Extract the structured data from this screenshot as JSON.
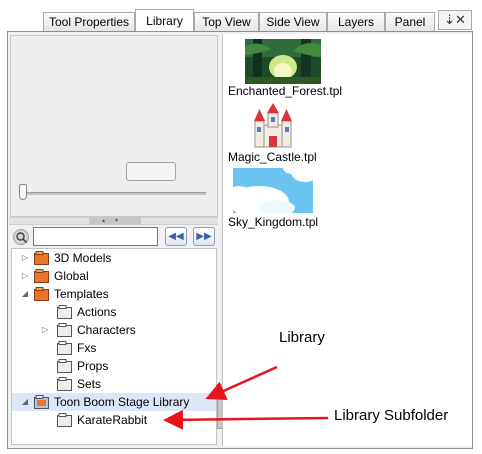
{
  "tabs": [
    {
      "label": "Tool Properties",
      "active": false
    },
    {
      "label": "Library",
      "active": true
    },
    {
      "label": "Top View",
      "active": false
    },
    {
      "label": "Side View",
      "active": false
    },
    {
      "label": "Layers",
      "active": false
    },
    {
      "label": "Panel",
      "active": false
    }
  ],
  "tab_controls": {
    "icon": "menu-close-icon",
    "glyph": "⇣✕"
  },
  "search": {
    "value": "",
    "placeholder": ""
  },
  "tree": {
    "items": [
      {
        "label": "3D Models",
        "expander": "collapsed",
        "icon": "folder-icon"
      },
      {
        "label": "Global",
        "expander": "collapsed",
        "icon": "folder-icon"
      },
      {
        "label": "Templates",
        "expander": "expanded",
        "icon": "folder-icon"
      },
      {
        "label": "Actions",
        "expander": "none",
        "icon": "subfolder-icon"
      },
      {
        "label": "Characters",
        "expander": "collapsed",
        "icon": "subfolder-icon"
      },
      {
        "label": "Fxs",
        "expander": "none",
        "icon": "subfolder-icon"
      },
      {
        "label": "Props",
        "expander": "none",
        "icon": "subfolder-icon"
      },
      {
        "label": "Sets",
        "expander": "none",
        "icon": "subfolder-icon"
      },
      {
        "label": "Toon Boom Stage Library",
        "expander": "expanded",
        "icon": "library-folder-icon",
        "selected": true
      },
      {
        "label": "KarateRabbit",
        "expander": "none",
        "icon": "subfolder-icon"
      }
    ]
  },
  "templates": [
    {
      "label": "Enchanted_Forest.tpl",
      "thumb": "forest-thumbnail"
    },
    {
      "label": "Magic_Castle.tpl",
      "thumb": "castle-thumbnail"
    },
    {
      "label": "Sky_Kingdom.tpl",
      "thumb": "sky-thumbnail"
    }
  ],
  "annotations": {
    "library": "Library",
    "library_subfolder": "Library Subfolder"
  },
  "colors": {
    "folder_orange": "#e8752a",
    "selection": "#dbe7f7",
    "arrow_red": "#e8141b"
  }
}
